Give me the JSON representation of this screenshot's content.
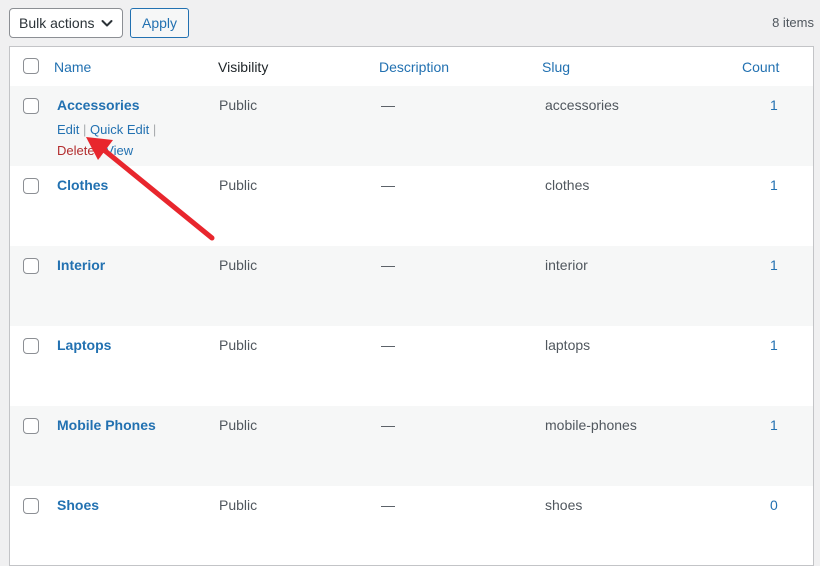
{
  "toolbar": {
    "bulk_actions_label": "Bulk actions",
    "apply_label": "Apply",
    "items_count": "8 items"
  },
  "table": {
    "headers": {
      "name": "Name",
      "visibility": "Visibility",
      "description": "Description",
      "slug": "Slug",
      "count": "Count"
    },
    "row_actions": {
      "edit": "Edit",
      "quick_edit": "Quick Edit",
      "delete": "Delete",
      "view": "View",
      "separator": "|"
    },
    "rows": [
      {
        "name": "Accessories",
        "visibility": "Public",
        "description": "—",
        "slug": "accessories",
        "count": "1"
      },
      {
        "name": "Clothes",
        "visibility": "Public",
        "description": "—",
        "slug": "clothes",
        "count": "1"
      },
      {
        "name": "Interior",
        "visibility": "Public",
        "description": "—",
        "slug": "interior",
        "count": "1"
      },
      {
        "name": "Laptops",
        "visibility": "Public",
        "description": "—",
        "slug": "laptops",
        "count": "1"
      },
      {
        "name": "Mobile Phones",
        "visibility": "Public",
        "description": "—",
        "slug": "mobile-phones",
        "count": "1"
      },
      {
        "name": "Shoes",
        "visibility": "Public",
        "description": "—",
        "slug": "shoes",
        "count": "0"
      }
    ]
  },
  "colors": {
    "link": "#2271b1",
    "delete": "#b32d2e",
    "annotation_arrow": "#e8262d"
  },
  "icons": {
    "select_chevron": "chevron-down-icon",
    "annotation": "arrow-annotation-icon"
  }
}
